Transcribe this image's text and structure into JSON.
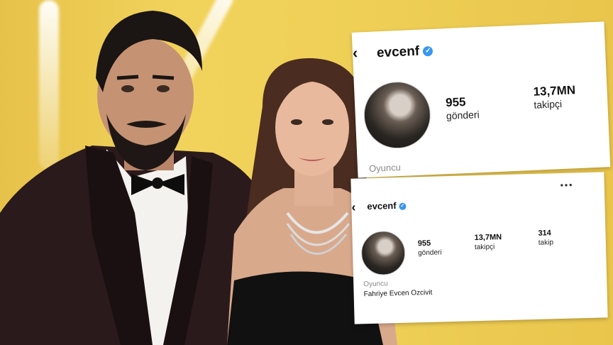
{
  "photo": {
    "subjects": [
      "man-in-tuxedo",
      "woman-in-black-dress"
    ]
  },
  "screenshot_top": {
    "username": "evcenf",
    "avatar": "profile-photo",
    "stats": [
      {
        "value": "955",
        "label": "gönderi"
      },
      {
        "value": "13,7MN",
        "label": "takipçi"
      }
    ],
    "bio": "Oyuncu"
  },
  "screenshot_bottom": {
    "username": "evcenf",
    "avatar": "profile-photo",
    "stats": [
      {
        "value": "955",
        "label": "gönderi"
      },
      {
        "value": "13,7MN",
        "label": "takipçi"
      },
      {
        "value": "314",
        "label": "takip"
      }
    ],
    "bio": "Oyuncu",
    "full_name": "Fahriye Evcen Ozcivit"
  },
  "icons": {
    "back": "chevron-left-icon",
    "verified": "verified-badge-icon",
    "more": "more-options-icon"
  },
  "colors": {
    "background": "#efcf56",
    "verified": "#3897f0",
    "card": "#ffffff"
  }
}
